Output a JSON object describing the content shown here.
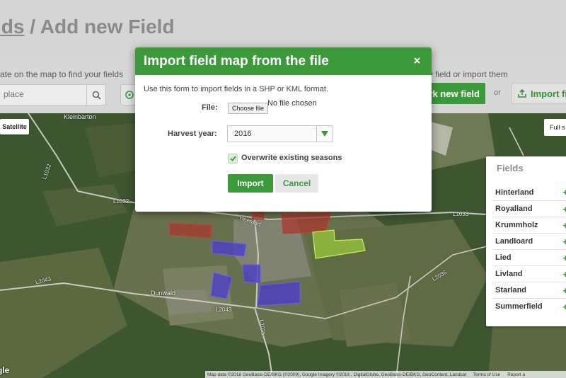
{
  "header": {
    "breadcrumb_link": "lds",
    "breadcrumb_separator": " / ",
    "title": "Add new Field"
  },
  "toolbar": {
    "hint_left": "ate on the map to find your fields",
    "hint_right": "w field or import them",
    "search_placeholder": "place",
    "mark_button": "rk new field",
    "or_text": "or",
    "import_files_button": "Import fi"
  },
  "map": {
    "satellite_button": "Satellite",
    "fullscreen_button": "Full s",
    "google_logo": "gle",
    "roads": [
      "L1032",
      "L1032",
      "L2043",
      "L2043",
      "L1035",
      "L2036",
      "L1033",
      "Heerdorf"
    ],
    "places": [
      "Kleinbarton",
      "Dunwald"
    ],
    "attribution": {
      "data": "Map data ©2016 GeoBasis-DE/BKG (©2009), Google Imagery ©2016 , DigitalGlobe, GeoBasis-DE/BKG, GeoContent, Landsat",
      "terms": "Terms of Use",
      "report": "Report a"
    }
  },
  "fields_panel": {
    "title": "Fields",
    "items": [
      "Hinterland",
      "Royalland",
      "Krummholz",
      "Landloard",
      "Lied",
      "Livland",
      "Starland",
      "Summerfield"
    ],
    "add_symbol": "+"
  },
  "modal": {
    "title": "Import field map from the file",
    "close_symbol": "×",
    "description": "Use this form to import fields in a SHP or KML format.",
    "file_label": "File:",
    "choose_file_button": "Choose file",
    "file_status": "No file chosen",
    "harvest_year_label": "Harvest year:",
    "harvest_year_value": "2016",
    "overwrite_label": "Overwrite existing seasons",
    "overwrite_checked": true,
    "import_button": "Import",
    "cancel_button": "Cancel"
  },
  "colors": {
    "accent": "#3c9a3b",
    "field_red": "#a8382d",
    "field_blue": "#4b3fc8",
    "field_lime": "#a6e03a"
  }
}
